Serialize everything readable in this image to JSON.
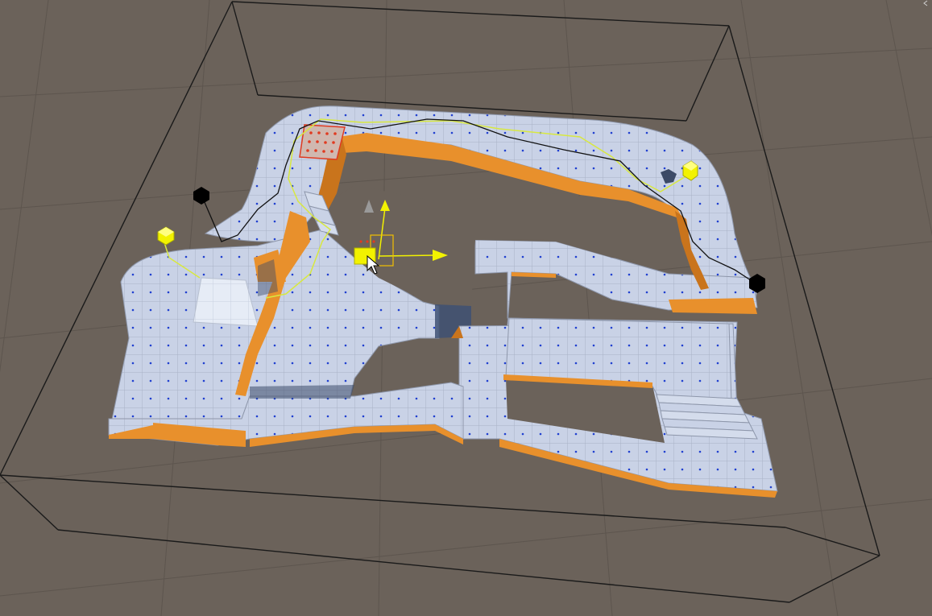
{
  "view": {
    "mode": "scene-view",
    "background_color": "#6b625a",
    "grid_line_color": "#5d554e",
    "projection": "perspective"
  },
  "colors": {
    "floor_top": "#c9d2e6",
    "floor_tile_line": "#a9b2c6",
    "floor_dot": "#2040d0",
    "wall_orange": "#e8902c",
    "wall_orange_dark": "#c9741c",
    "bounds_box": "#1a1a1a",
    "gizmo_yellow": "#f2f200",
    "path_yellow": "#d8e840",
    "path_black": "#111111",
    "selection_red": "#e03a20"
  },
  "gizmos": {
    "transform_handle": "move-gizmo",
    "probe_left": "light-probe",
    "probe_right": "light-probe",
    "waypoint_markers": [
      "waypoint-black",
      "waypoint-black",
      "waypoint-dark"
    ]
  },
  "corner_icon": "collapse-chevron-icon"
}
